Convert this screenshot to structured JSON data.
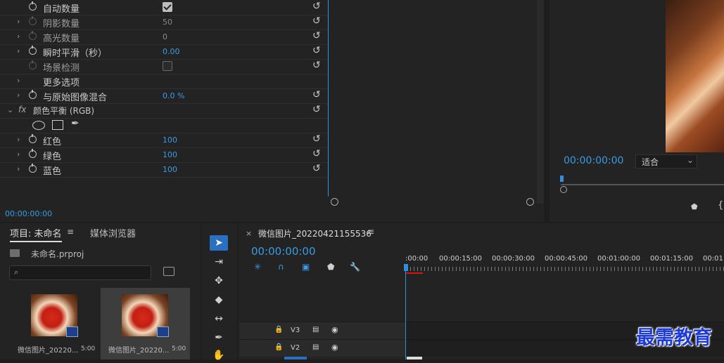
{
  "effects": {
    "rows": [
      {
        "label": "自动数量",
        "control": "checkbox",
        "checked": true,
        "chevron": "",
        "stopwatch": true
      },
      {
        "label": "阴影数量",
        "value": "50",
        "value_style": "dim",
        "chevron": "›",
        "stopwatch": "dim",
        "label_style": "dim"
      },
      {
        "label": "高光数量",
        "value": "0",
        "value_style": "dim",
        "chevron": "›",
        "stopwatch": "dim",
        "label_style": "dim"
      },
      {
        "label": "瞬时平滑（秒）",
        "value": "0.00",
        "value_style": "blue",
        "chevron": "›",
        "stopwatch": true
      },
      {
        "label": "场景检测",
        "control": "checkbox",
        "checked": false,
        "chevron": "",
        "stopwatch": "dim",
        "label_style": "dim"
      },
      {
        "label": "更多选项",
        "chevron": "›",
        "stopwatch": false
      },
      {
        "label": "与原始图像混合",
        "value": "0.0 %",
        "value_style": "blue",
        "chevron": "›",
        "stopwatch": true
      },
      {
        "label": "颜色平衡 (RGB)",
        "fx": "fx",
        "chevron": "⌄",
        "stopwatch": false
      },
      {
        "label": "",
        "mask_tools": true
      },
      {
        "label": "红色",
        "value": "100",
        "value_style": "blue",
        "chevron": "›",
        "stopwatch": true
      },
      {
        "label": "绿色",
        "value": "100",
        "value_style": "blue",
        "chevron": "›",
        "stopwatch": true
      },
      {
        "label": "蓝色",
        "value": "100",
        "value_style": "blue",
        "chevron": "›",
        "stopwatch": true
      }
    ],
    "timecode": "00:00:00:00",
    "reset_icon": "reset-icon"
  },
  "monitor": {
    "timecode": "00:00:00:00",
    "fit_label": "适合",
    "fit_caret": "⌄"
  },
  "project": {
    "tab_project": "项目: 未命名",
    "tab_media": "媒体浏览器",
    "menu": "≡",
    "file_name": "未命名.prproj",
    "search_placeholder": "",
    "items": [
      {
        "name": "微信图片_20220...",
        "duration": "5:00"
      },
      {
        "name": "微信图片_20220...",
        "duration": "5:00"
      }
    ]
  },
  "timeline": {
    "close": "×",
    "sequence_name": "微信图片_20220421155536",
    "menu": "≡",
    "timecode": "00:00:00:00",
    "ruler_labels": [
      ":00:00",
      "00:00:15:00",
      "00:00:30:00",
      "00:00:45:00",
      "00:01:00:00",
      "00:01:15:00",
      "00:01:"
    ],
    "tracks": [
      {
        "name": "V3"
      },
      {
        "name": "V2"
      }
    ]
  },
  "watermark": "最需教育",
  "colors": {
    "accent_blue": "#3a9be3",
    "panel": "#232323",
    "watermark": "#1e3bd6"
  }
}
